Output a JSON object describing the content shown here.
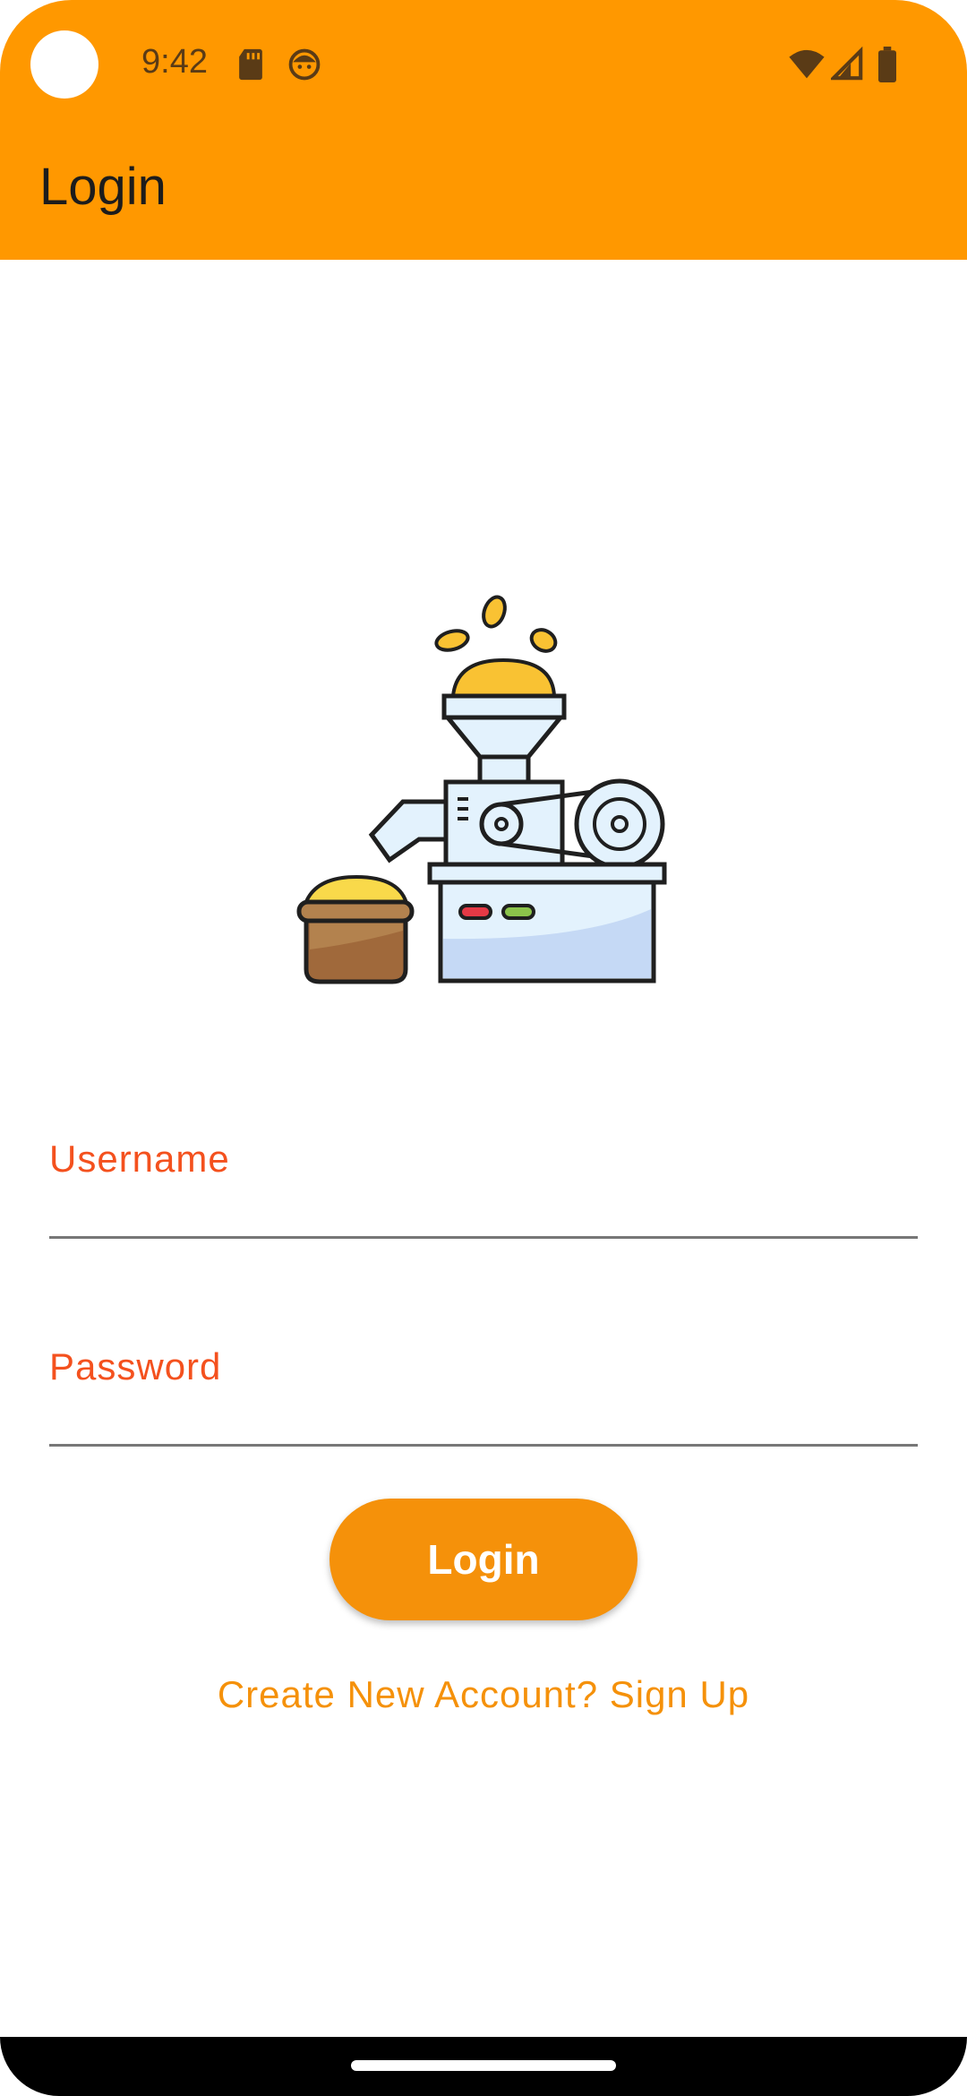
{
  "status_bar": {
    "time": "9:42",
    "icons": [
      "sd-card-icon",
      "face-icon",
      "wifi-icon",
      "signal-icon",
      "battery-icon"
    ]
  },
  "app_bar": {
    "title": "Login"
  },
  "hero": {
    "icon": "grain-mill-icon"
  },
  "form": {
    "username_label": "Username",
    "username_value": "",
    "password_label": "Password",
    "password_value": "",
    "login_button": "Login",
    "signup_link": "Create New Account? Sign Up"
  },
  "colors": {
    "primary": "#FF9800",
    "accent_label": "#F4511E",
    "button": "#F5910A"
  }
}
